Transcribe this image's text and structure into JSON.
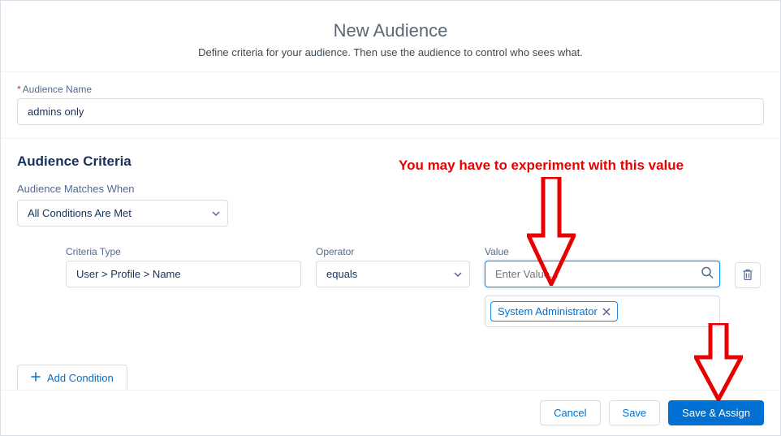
{
  "header": {
    "title": "New Audience",
    "subtitle": "Define criteria for your audience. Then use the audience to control who sees what."
  },
  "name_section": {
    "label": "Audience Name",
    "value": "admins only"
  },
  "criteria": {
    "heading": "Audience Criteria",
    "matches_label": "Audience Matches When",
    "matches_value": "All Conditions Are Met",
    "columns": {
      "type_label": "Criteria Type",
      "type_value": "User > Profile > Name",
      "operator_label": "Operator",
      "operator_value": "equals",
      "value_label": "Value",
      "value_placeholder": "Enter Value..."
    },
    "selected_values": [
      "System Administrator"
    ],
    "add_condition_label": "Add Condition"
  },
  "footer": {
    "cancel": "Cancel",
    "save": "Save",
    "save_assign": "Save & Assign"
  },
  "annotations": {
    "hint_text": "You may have to experiment with this value"
  }
}
